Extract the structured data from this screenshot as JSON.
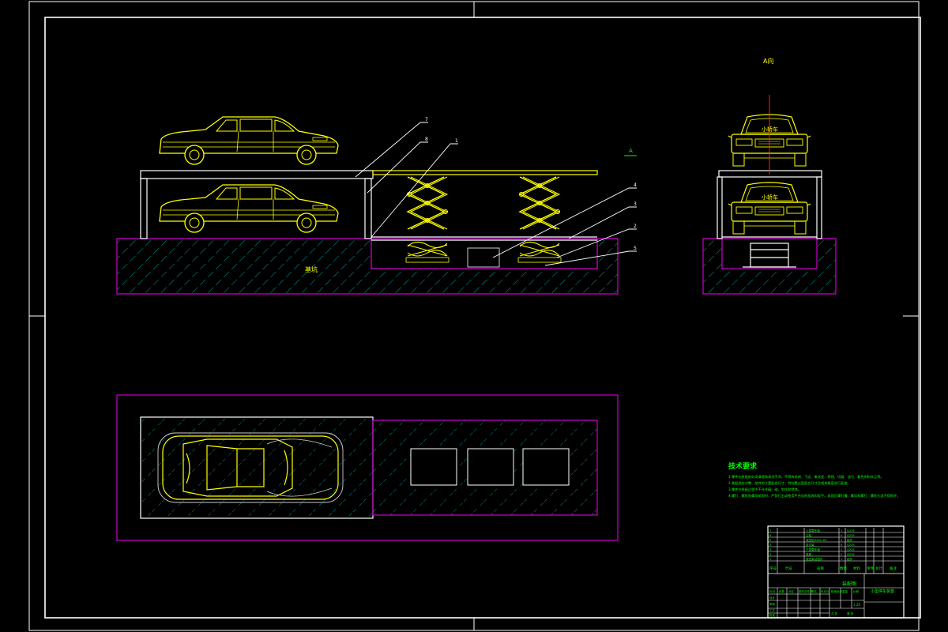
{
  "colors": {
    "background": "#000000",
    "frame": "#ffffff",
    "car": "#ffff00",
    "pit_outline": "#cc00cc",
    "hatch": "#00c8c8",
    "notes": "#00ff00",
    "centerline": "#ff2020"
  },
  "elevation": {
    "ground_label": "基坑",
    "part_markers": [
      "7",
      "8",
      "1",
      "4",
      "3",
      "2",
      "5"
    ],
    "view_marker": "A"
  },
  "side_view": {
    "title": "A向",
    "upper_car_label": "小轿车",
    "lower_car_label": "小轿车"
  },
  "technical_notes": {
    "title": "技术要求",
    "items": [
      "1.零件在装配前必须清理和清洗干净，不得有毛刺、飞边、氧化皮、锈蚀、切屑、油污、着色剂和灰尘等。",
      "2.装配前应对零、部件的主要配合尺寸，特别是过盈配合尺寸及相关精度进行复查。",
      "3.零件在装配过程中不允许磕、碰、划伤和锈蚀。",
      "4.螺钉、螺栓和螺母紧固时，严禁打击或使用不合适的旋具和扳手。紧固后螺钉槽、螺母和螺钉、螺栓头部不得损坏。"
    ]
  },
  "title_block": {
    "bom_rows": [
      {
        "no": "7",
        "name": "上层载车板",
        "qty": "1",
        "material": "Q235"
      },
      {
        "no": "6",
        "name": "立柱",
        "qty": "4",
        "material": "Q235"
      },
      {
        "no": "5",
        "name": "液压缸HSGL-63",
        "qty": "4",
        "material": "组件"
      },
      {
        "no": "4",
        "name": "剪叉臂",
        "qty": "8",
        "material": "Q235"
      },
      {
        "no": "3",
        "name": "下层载车板",
        "qty": "1",
        "material": "Q235"
      },
      {
        "no": "2",
        "name": "底座",
        "qty": "2",
        "material": "Q235"
      },
      {
        "no": "1",
        "name": "液压泵站组件",
        "qty": "1",
        "material": "组件"
      }
    ],
    "header": [
      "序号",
      "代号",
      "名称",
      "数量",
      "材料",
      "单件",
      "总计",
      "备注"
    ],
    "drawing_no": "装配图",
    "drawing_name": "小型停车装置",
    "scale_labels": [
      "标记",
      "处数",
      "分区",
      "更改文件号",
      "签名",
      "年月日"
    ],
    "approval_labels": [
      "设计",
      "审核",
      "工艺",
      "批准"
    ],
    "stage_labels": [
      "阶段标记",
      "重量",
      "比例"
    ],
    "sheet_labels": [
      "共 张",
      "第 张"
    ],
    "scale_value": "1:20"
  }
}
